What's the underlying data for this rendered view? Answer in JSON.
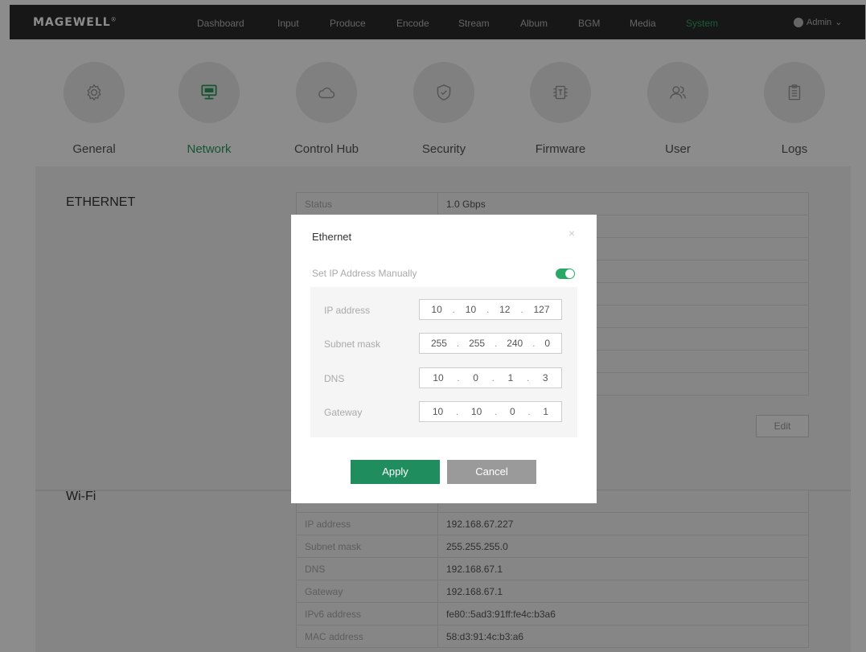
{
  "brand": {
    "logo": "MAGEWELL"
  },
  "nav": {
    "items": [
      {
        "label": "Dashboard"
      },
      {
        "label": "Input"
      },
      {
        "label": "Produce"
      },
      {
        "label": "Encode"
      },
      {
        "label": "Stream"
      },
      {
        "label": "Album"
      },
      {
        "label": "BGM"
      },
      {
        "label": "Media"
      },
      {
        "label": "System"
      }
    ],
    "active": "System",
    "user": "Admin"
  },
  "tabs": [
    {
      "label": "General",
      "icon": "gear-icon"
    },
    {
      "label": "Network",
      "icon": "monitor-icon"
    },
    {
      "label": "Control Hub",
      "icon": "cloud-icon"
    },
    {
      "label": "Security",
      "icon": "shield-check-icon"
    },
    {
      "label": "Firmware",
      "icon": "chip-icon"
    },
    {
      "label": "User",
      "icon": "users-icon"
    },
    {
      "label": "Logs",
      "icon": "clipboard-icon"
    }
  ],
  "active_tab": "Network",
  "ethernet": {
    "title": "ETHERNET",
    "rows": [
      {
        "key": "Status",
        "value": "1.0 Gbps"
      },
      {
        "key": "",
        "value": ""
      },
      {
        "key": "",
        "value": ""
      },
      {
        "key": "",
        "value": ""
      },
      {
        "key": "",
        "value": ""
      },
      {
        "key": "",
        "value": ""
      },
      {
        "key": "",
        "value": ""
      },
      {
        "key": "",
        "value": ""
      },
      {
        "key": "",
        "value": ""
      }
    ],
    "edit_label": "Edit"
  },
  "wifi": {
    "title": "Wi-Fi",
    "rows": [
      {
        "key": "",
        "value": ""
      },
      {
        "key": "IP address",
        "value": "192.168.67.227"
      },
      {
        "key": "Subnet mask",
        "value": "255.255.255.0"
      },
      {
        "key": "DNS",
        "value": "192.168.67.1"
      },
      {
        "key": "Gateway",
        "value": "192.168.67.1"
      },
      {
        "key": "IPv6 address",
        "value": "fe80::5ad3:91ff:fe4c:b3a6"
      },
      {
        "key": "MAC address",
        "value": "58:d3:91:4c:b3:a6"
      }
    ]
  },
  "modal": {
    "title": "Ethernet",
    "close_glyph": "×",
    "manual_label": "Set IP Address Manually",
    "manual_enabled": true,
    "fields": [
      {
        "label": "IP address",
        "octets": [
          "10",
          "10",
          "12",
          "127"
        ]
      },
      {
        "label": "Subnet mask",
        "octets": [
          "255",
          "255",
          "240",
          "0"
        ]
      },
      {
        "label": "DNS",
        "octets": [
          "10",
          "0",
          "1",
          "3"
        ]
      },
      {
        "label": "Gateway",
        "octets": [
          "10",
          "10",
          "0",
          "1"
        ]
      }
    ],
    "apply_label": "Apply",
    "cancel_label": "Cancel"
  },
  "colors": {
    "accent": "#2aa865",
    "apply": "#1f8d5e",
    "topbar": "#2b2b2b"
  }
}
